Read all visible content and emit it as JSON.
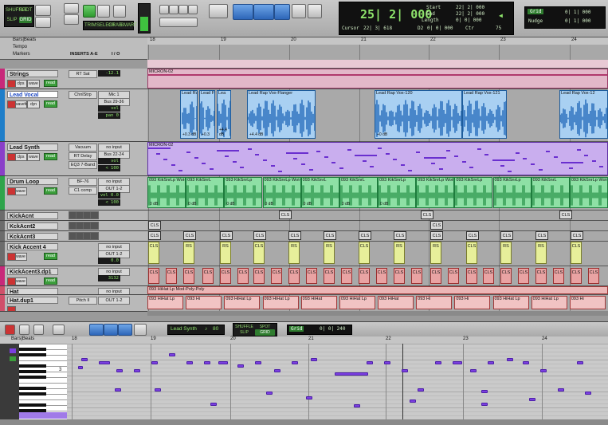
{
  "toolbar": {
    "modes": [
      "SHUFFLE",
      "SPOT",
      "SLIP",
      "GRID"
    ],
    "mini_buttons": [
      "TRIM",
      "SELECT",
      "GRAB",
      "SMART"
    ],
    "counter": {
      "main": "25| 2| 000",
      "cursor_label": "Cursor",
      "cursor_value": "22| 3| 618",
      "start_label": "Start",
      "start_value": "22| 2| 000",
      "end_label": "End",
      "end_value": "22| 2| 000",
      "length_label": "Length",
      "length_value": "0| 0| 000",
      "d2_label": "D2",
      "d2_value": "0| 0| 000",
      "ctr": "Ctr",
      "tempo": "75"
    },
    "grid": {
      "label": "Grid",
      "value": "0| 1| 000",
      "nudge_label": "Nudge",
      "nudge_value": "0| 1| 000"
    }
  },
  "header": {
    "ruler_label": "Bars|Beats",
    "tempo_label": "Tempo",
    "markers_label": "Markers",
    "inserts_label": "INSERTS A-E",
    "io_label": "I / O"
  },
  "ruler_bars": [
    "18",
    "19",
    "20",
    "21",
    "22",
    "23",
    "24"
  ],
  "tracks": [
    {
      "name": "Strings",
      "inserts": [
        "RT Sat"
      ],
      "io": [
        "-12.1"
      ],
      "buttons": [
        "clps",
        "wave",
        "read"
      ],
      "region": "MICRON-02",
      "color": "#c8287a"
    },
    {
      "name": "Lead Vocal",
      "inserts": [
        "ChnlStrp"
      ],
      "io": [
        "Mic 1",
        "Bus 29-36",
        "vol +1.4",
        "pan 0"
      ],
      "buttons": [
        "waveform",
        "dyn",
        "read",
        "Monophonic"
      ],
      "color": "#1f7ec9",
      "clips": [
        "Lead Ra",
        "Lead F",
        "Lea",
        "Lead Rap Vox-Flanger",
        "Lead Rap Vox-120",
        "Lead Rap Vox-121",
        "Lead Rap Vox-12"
      ],
      "gains": [
        "+0.3 dB",
        "+0.3",
        "+4.4 dB",
        "+4.4 dB",
        "+0 dB"
      ]
    },
    {
      "name": "Lead Synth",
      "inserts": [
        "Vacuum",
        "RT Delay",
        "EQ3 7-Band"
      ],
      "io": [
        "no input",
        "Bus 22-24",
        "vol -7.8",
        "< 100",
        "100 >"
      ],
      "buttons": [
        "clps",
        "wave",
        "read"
      ],
      "region": "MICRON-02",
      "color": "#8a3fc9"
    },
    {
      "name": "Drum Loop",
      "inserts": [
        "BF-76",
        "C1 comp"
      ],
      "io": [
        "no input",
        "OUT 1-2",
        "vol 0.0",
        "< 100",
        "100 >"
      ],
      "buttons": [
        "wave",
        "read"
      ],
      "color": "#2ea44b",
      "clips": [
        "093 KikSnrLp Wot-Poly-Poi",
        "093 KikSnrL",
        "093 KikSnrLp",
        "093 KikSnrLp Wot-Poly-Poly-04",
        "093 KikSnrL",
        "093 KikSnrL",
        "093 KikSnrLp",
        "093 KikSnrLp Wot-Poly-Poly",
        "093 KikSnrLp",
        "093 KikSnrLp",
        "093 KikSnrL",
        "093 KikSnrLp Wot-Poly-Poly-"
      ],
      "gains": [
        "0 dB",
        "0 dB",
        "0 dB",
        "0 dB",
        "0 dB",
        "0 dB",
        "0 dB"
      ]
    },
    {
      "name": "KickAcnt",
      "color": "#6c6c6c"
    },
    {
      "name": "KckAcnt2",
      "color": "#6c6c6c"
    },
    {
      "name": "KckAcnt3",
      "color": "#6c6c6c"
    },
    {
      "name": "Kick Accent 4",
      "io": [
        "no input",
        "OUT 1-2",
        "0.0"
      ],
      "buttons": [
        "wave",
        "read"
      ],
      "color": "#6c6c6c"
    },
    {
      "name": "KickAcent3.dp1",
      "io": [
        "no input",
        "3132"
      ],
      "buttons": [
        "wave",
        "read"
      ],
      "color": "#c8287a"
    },
    {
      "name": "Hat",
      "io": [
        "no input",
        "OUT 1-2",
        "0.0"
      ],
      "buttons": [
        "wave",
        "read"
      ],
      "region": "093 HiHat Lp Mod-Poly-Poly",
      "color": "#d0506a"
    },
    {
      "name": "Hat.dup1",
      "inserts": [
        "Pitch II"
      ],
      "io": [
        "OUT 1-2"
      ],
      "color": "#d0506a",
      "clips": [
        "093 HiHat Lp",
        "093 Hi",
        "093 HiHat Lp",
        "093 HiHat Lp",
        "093 HiHat",
        "093 HiHat Lp",
        "093 HiHat",
        "093 Hi",
        "093 Hi",
        "093 HiHat Lp",
        "093 HiHat Lp",
        "093 Hi"
      ]
    }
  ],
  "cls_label": "CLS",
  "rs_label": "RS",
  "midi_editor": {
    "track": "Lead Synth",
    "tempo": "80",
    "grid_label": "Grid",
    "grid_value": "0| 0| 240",
    "modes": [
      "SHUFFLE",
      "SPOT",
      "SLIP",
      "GRID"
    ],
    "ruler_label": "Bars|Beats",
    "bars": [
      "18",
      "19",
      "20",
      "21",
      "22",
      "23",
      "24"
    ],
    "key_label": "3"
  }
}
